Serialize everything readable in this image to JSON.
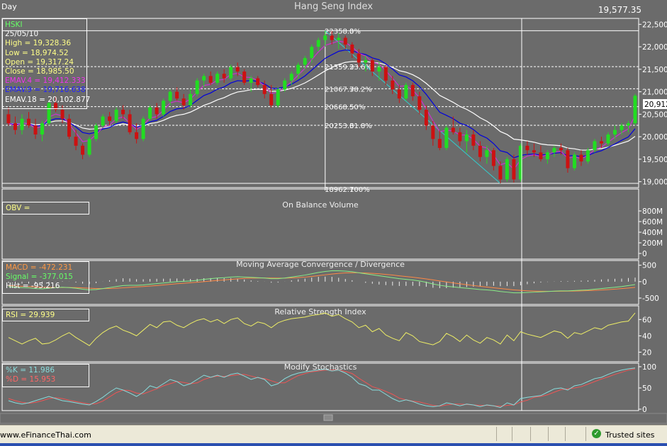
{
  "window": {
    "period": "Day",
    "title": "Hang Seng Index",
    "last_price": "19,577.35"
  },
  "colors": {
    "background": "#6b6b6b",
    "panel_border": "#ffffff",
    "up_candle": "#22dd22",
    "down_candle": "#cc1111",
    "ema4": "#cc33cc",
    "ema9": "#0000dd",
    "ema18": "#ffffff",
    "fib_line": "#ffffff",
    "trend_line": "#33cccc",
    "macd_line": "#88ee88",
    "macd_signal": "#ff8844",
    "rsi_line": "#eeee66",
    "stoch_k": "#88dddd",
    "stoch_d": "#ee5555",
    "info_text_yellow": "#ffff88",
    "info_text_green": "#66ff66"
  },
  "price_panel": {
    "info": {
      "symbol": "HSKI",
      "date": "25/05/10",
      "high": "High  = 19,328.36",
      "low": "Low  = 18,974.52",
      "open": "Open = 19,317.24",
      "close": "Close = 18,985.50",
      "ema4": "EMAV.4 = 19,412.333",
      "ema9": "EMAV.9 = 19,716.638",
      "ema18": "EMAV.18 = 20,102.877"
    },
    "axis_labels": [
      "22,500",
      "22,000",
      "21,500",
      "21,000",
      "20,500",
      "20,000",
      "19,500",
      "19,000"
    ],
    "last_value_tag": "20,912",
    "fib_levels": [
      {
        "value": "22358.3",
        "pct": "0%"
      },
      {
        "value": "21559.3",
        "pct": "23.6%"
      },
      {
        "value": "21067.7",
        "pct": "38.2%"
      },
      {
        "value": "20668.5",
        "pct": "50%"
      },
      {
        "value": "20253.3",
        "pct": "61.8%"
      },
      {
        "value": "18962.7",
        "pct": "100%"
      }
    ]
  },
  "obv_panel": {
    "title": "On Balance Volume",
    "info": "OBV =",
    "axis_labels": [
      "800M",
      "600M",
      "400M",
      "200M",
      "0"
    ]
  },
  "macd_panel": {
    "title": "Moving Average Convergence / Divergence",
    "info": {
      "macd": "MACD = -472.231",
      "signal": "Signal = -377.015",
      "hist": "Hist = -95.216"
    },
    "axis_labels": [
      "500",
      "0",
      "-500"
    ]
  },
  "rsi_panel": {
    "title": "Relative Strength Index",
    "info": "RSI = 29.939",
    "axis_labels": [
      "60",
      "40",
      "20"
    ]
  },
  "stoch_panel": {
    "title": "Modify Stochastics",
    "info": {
      "k": "%K = 11.986",
      "d": "%D = 15.953"
    },
    "axis_labels": [
      "100",
      "50",
      "0"
    ]
  },
  "statusbar": {
    "url": "www.eFinanceThai.com",
    "security": "Trusted sites"
  },
  "chart_data": {
    "type": "candlestick",
    "title": "Hang Seng Index",
    "price_range": [
      18900,
      22600
    ],
    "candles": [
      {
        "o": 20500,
        "h": 20650,
        "l": 20250,
        "c": 20300
      },
      {
        "o": 20300,
        "h": 20450,
        "l": 20050,
        "c": 20150
      },
      {
        "o": 20150,
        "h": 20500,
        "l": 20050,
        "c": 20400
      },
      {
        "o": 20400,
        "h": 20550,
        "l": 20200,
        "c": 20250
      },
      {
        "o": 20250,
        "h": 20400,
        "l": 19950,
        "c": 20050
      },
      {
        "o": 20050,
        "h": 20350,
        "l": 19900,
        "c": 20300
      },
      {
        "o": 20300,
        "h": 20800,
        "l": 20250,
        "c": 20750
      },
      {
        "o": 20750,
        "h": 20900,
        "l": 20550,
        "c": 20600
      },
      {
        "o": 20600,
        "h": 20700,
        "l": 20300,
        "c": 20400
      },
      {
        "o": 20400,
        "h": 20500,
        "l": 19950,
        "c": 20000
      },
      {
        "o": 20000,
        "h": 20150,
        "l": 19700,
        "c": 19800
      },
      {
        "o": 19800,
        "h": 19850,
        "l": 19500,
        "c": 19600
      },
      {
        "o": 19600,
        "h": 20000,
        "l": 19550,
        "c": 19950
      },
      {
        "o": 19950,
        "h": 20300,
        "l": 19900,
        "c": 20250
      },
      {
        "o": 20250,
        "h": 20500,
        "l": 20200,
        "c": 20450
      },
      {
        "o": 20450,
        "h": 20550,
        "l": 20250,
        "c": 20350
      },
      {
        "o": 20350,
        "h": 20650,
        "l": 20300,
        "c": 20600
      },
      {
        "o": 20600,
        "h": 20700,
        "l": 20400,
        "c": 20500
      },
      {
        "o": 20500,
        "h": 20600,
        "l": 20050,
        "c": 20100
      },
      {
        "o": 20100,
        "h": 20300,
        "l": 19850,
        "c": 19950
      },
      {
        "o": 19950,
        "h": 20450,
        "l": 19900,
        "c": 20400
      },
      {
        "o": 20400,
        "h": 20700,
        "l": 20350,
        "c": 20650
      },
      {
        "o": 20650,
        "h": 20750,
        "l": 20400,
        "c": 20500
      },
      {
        "o": 20500,
        "h": 20850,
        "l": 20450,
        "c": 20800
      },
      {
        "o": 20800,
        "h": 21050,
        "l": 20700,
        "c": 21000
      },
      {
        "o": 21000,
        "h": 21100,
        "l": 20800,
        "c": 20850
      },
      {
        "o": 20850,
        "h": 20950,
        "l": 20600,
        "c": 20700
      },
      {
        "o": 20700,
        "h": 21050,
        "l": 20650,
        "c": 20950
      },
      {
        "o": 20950,
        "h": 21300,
        "l": 20900,
        "c": 21250
      },
      {
        "o": 21250,
        "h": 21400,
        "l": 21100,
        "c": 21350
      },
      {
        "o": 21350,
        "h": 21450,
        "l": 21150,
        "c": 21200
      },
      {
        "o": 21200,
        "h": 21450,
        "l": 21150,
        "c": 21400
      },
      {
        "o": 21400,
        "h": 21500,
        "l": 21200,
        "c": 21300
      },
      {
        "o": 21300,
        "h": 21600,
        "l": 21250,
        "c": 21550
      },
      {
        "o": 21550,
        "h": 21650,
        "l": 21350,
        "c": 21450
      },
      {
        "o": 21450,
        "h": 21500,
        "l": 21150,
        "c": 21200
      },
      {
        "o": 21200,
        "h": 21350,
        "l": 21000,
        "c": 21300
      },
      {
        "o": 21300,
        "h": 21350,
        "l": 21100,
        "c": 21150
      },
      {
        "o": 21150,
        "h": 21250,
        "l": 20850,
        "c": 20950
      },
      {
        "o": 20950,
        "h": 21150,
        "l": 20650,
        "c": 20700
      },
      {
        "o": 20700,
        "h": 21100,
        "l": 20650,
        "c": 21050
      },
      {
        "o": 21050,
        "h": 21300,
        "l": 21000,
        "c": 21250
      },
      {
        "o": 21250,
        "h": 21450,
        "l": 21150,
        "c": 21400
      },
      {
        "o": 21400,
        "h": 21650,
        "l": 21300,
        "c": 21600
      },
      {
        "o": 21600,
        "h": 21800,
        "l": 21500,
        "c": 21750
      },
      {
        "o": 21750,
        "h": 22050,
        "l": 21650,
        "c": 22000
      },
      {
        "o": 22000,
        "h": 22200,
        "l": 21900,
        "c": 22150
      },
      {
        "o": 22150,
        "h": 22358,
        "l": 22000,
        "c": 22250
      },
      {
        "o": 22250,
        "h": 22350,
        "l": 22050,
        "c": 22150
      },
      {
        "o": 22150,
        "h": 22300,
        "l": 21950,
        "c": 22200
      },
      {
        "o": 22200,
        "h": 22250,
        "l": 21950,
        "c": 22050
      },
      {
        "o": 22050,
        "h": 22100,
        "l": 21750,
        "c": 21850
      },
      {
        "o": 21850,
        "h": 21950,
        "l": 21550,
        "c": 21650
      },
      {
        "o": 21650,
        "h": 21800,
        "l": 21450,
        "c": 21700
      },
      {
        "o": 21700,
        "h": 21750,
        "l": 21350,
        "c": 21450
      },
      {
        "o": 21450,
        "h": 21650,
        "l": 21250,
        "c": 21550
      },
      {
        "o": 21550,
        "h": 21600,
        "l": 21150,
        "c": 21250
      },
      {
        "o": 21250,
        "h": 21350,
        "l": 20950,
        "c": 21050
      },
      {
        "o": 21050,
        "h": 21150,
        "l": 20750,
        "c": 20850
      },
      {
        "o": 20850,
        "h": 21200,
        "l": 20800,
        "c": 21150
      },
      {
        "o": 21150,
        "h": 21200,
        "l": 20800,
        "c": 20900
      },
      {
        "o": 20900,
        "h": 21000,
        "l": 20500,
        "c": 20600
      },
      {
        "o": 20600,
        "h": 20700,
        "l": 20150,
        "c": 20250
      },
      {
        "o": 20250,
        "h": 20350,
        "l": 19800,
        "c": 19950
      },
      {
        "o": 19950,
        "h": 20150,
        "l": 19700,
        "c": 19750
      },
      {
        "o": 19750,
        "h": 20250,
        "l": 19700,
        "c": 20200
      },
      {
        "o": 20200,
        "h": 20450,
        "l": 20050,
        "c": 20100
      },
      {
        "o": 20100,
        "h": 20200,
        "l": 19800,
        "c": 19900
      },
      {
        "o": 19900,
        "h": 20150,
        "l": 19650,
        "c": 20050
      },
      {
        "o": 20050,
        "h": 20150,
        "l": 19700,
        "c": 19800
      },
      {
        "o": 19800,
        "h": 19900,
        "l": 19450,
        "c": 19550
      },
      {
        "o": 19550,
        "h": 19800,
        "l": 19400,
        "c": 19700
      },
      {
        "o": 19700,
        "h": 19750,
        "l": 19250,
        "c": 19350
      },
      {
        "o": 19350,
        "h": 19450,
        "l": 18962,
        "c": 19050
      },
      {
        "o": 19050,
        "h": 19550,
        "l": 19000,
        "c": 19500
      },
      {
        "o": 19500,
        "h": 19600,
        "l": 18980,
        "c": 19050
      },
      {
        "o": 19050,
        "h": 19850,
        "l": 19000,
        "c": 19800
      },
      {
        "o": 19800,
        "h": 19900,
        "l": 19600,
        "c": 19700
      },
      {
        "o": 19700,
        "h": 19850,
        "l": 19550,
        "c": 19650
      },
      {
        "o": 19650,
        "h": 19800,
        "l": 19450,
        "c": 19500
      },
      {
        "o": 19500,
        "h": 19700,
        "l": 19400,
        "c": 19650
      },
      {
        "o": 19650,
        "h": 19800,
        "l": 19550,
        "c": 19750
      },
      {
        "o": 19750,
        "h": 19850,
        "l": 19600,
        "c": 19700
      },
      {
        "o": 19700,
        "h": 19750,
        "l": 19200,
        "c": 19300
      },
      {
        "o": 19300,
        "h": 19650,
        "l": 19250,
        "c": 19600
      },
      {
        "o": 19600,
        "h": 19700,
        "l": 19350,
        "c": 19450
      },
      {
        "o": 19450,
        "h": 19750,
        "l": 19400,
        "c": 19700
      },
      {
        "o": 19700,
        "h": 19950,
        "l": 19650,
        "c": 19900
      },
      {
        "o": 19900,
        "h": 20000,
        "l": 19750,
        "c": 19850
      },
      {
        "o": 19850,
        "h": 20100,
        "l": 19800,
        "c": 20050
      },
      {
        "o": 20050,
        "h": 20250,
        "l": 19950,
        "c": 20150
      },
      {
        "o": 20150,
        "h": 20300,
        "l": 20050,
        "c": 20250
      },
      {
        "o": 20250,
        "h": 20350,
        "l": 20100,
        "c": 20300
      },
      {
        "o": 20300,
        "h": 20950,
        "l": 20250,
        "c": 20912
      }
    ],
    "macd_range": [
      -650,
      600
    ],
    "rsi_range": [
      10,
      75
    ],
    "stoch_range": [
      0,
      105
    ],
    "macd": [
      -150,
      -170,
      -180,
      -190,
      -210,
      -220,
      -200,
      -180,
      -170,
      -180,
      -200,
      -230,
      -250,
      -240,
      -210,
      -180,
      -150,
      -120,
      -110,
      -110,
      -100,
      -80,
      -60,
      -40,
      -20,
      0,
      10,
      20,
      40,
      70,
      90,
      110,
      120,
      140,
      150,
      140,
      130,
      120,
      110,
      90,
      90,
      110,
      140,
      170,
      200,
      240,
      280,
      310,
      330,
      330,
      320,
      300,
      270,
      240,
      210,
      180,
      150,
      120,
      90,
      70,
      50,
      20,
      -20,
      -70,
      -110,
      -140,
      -160,
      -180,
      -200,
      -220,
      -240,
      -250,
      -270,
      -300,
      -320,
      -340,
      -340,
      -330,
      -320,
      -310,
      -300,
      -290,
      -280,
      -280,
      -270,
      -260,
      -250,
      -230,
      -210,
      -190,
      -170,
      -150,
      -120,
      -90
    ],
    "signal": [
      -120,
      -130,
      -140,
      -150,
      -160,
      -170,
      -175,
      -178,
      -178,
      -178,
      -182,
      -190,
      -200,
      -210,
      -212,
      -208,
      -200,
      -188,
      -174,
      -160,
      -148,
      -134,
      -118,
      -100,
      -82,
      -64,
      -48,
      -34,
      -18,
      0,
      18,
      36,
      52,
      70,
      86,
      98,
      106,
      110,
      112,
      110,
      108,
      108,
      114,
      124,
      138,
      158,
      182,
      208,
      232,
      252,
      266,
      272,
      270,
      264,
      252,
      238,
      220,
      200,
      178,
      156,
      134,
      110,
      84,
      54,
      22,
      -8,
      -38,
      -66,
      -92,
      -118,
      -142,
      -164,
      -186,
      -208,
      -230,
      -250,
      -266,
      -278,
      -286,
      -292,
      -294,
      -294,
      -292,
      -290,
      -286,
      -280,
      -274,
      -266,
      -254,
      -242,
      -228,
      -212,
      -194,
      -172
    ],
    "rsi": [
      38,
      34,
      30,
      34,
      37,
      30,
      31,
      35,
      40,
      44,
      38,
      33,
      28,
      37,
      44,
      49,
      52,
      47,
      44,
      40,
      47,
      54,
      50,
      57,
      58,
      53,
      50,
      55,
      59,
      61,
      57,
      60,
      55,
      60,
      62,
      55,
      52,
      57,
      55,
      50,
      56,
      59,
      61,
      62,
      63,
      65,
      66,
      68,
      64,
      66,
      61,
      57,
      50,
      53,
      45,
      49,
      41,
      37,
      34,
      44,
      40,
      33,
      31,
      29,
      33,
      43,
      39,
      33,
      41,
      35,
      31,
      38,
      35,
      30,
      41,
      34,
      45,
      42,
      40,
      38,
      42,
      46,
      44,
      37,
      44,
      42,
      46,
      50,
      48,
      53,
      55,
      57,
      58,
      68
    ],
    "stoch_k": [
      20,
      15,
      12,
      15,
      20,
      25,
      30,
      25,
      20,
      18,
      15,
      12,
      10,
      18,
      28,
      40,
      50,
      45,
      38,
      30,
      40,
      55,
      50,
      60,
      70,
      65,
      55,
      60,
      70,
      80,
      75,
      80,
      75,
      82,
      85,
      78,
      70,
      75,
      70,
      55,
      60,
      72,
      80,
      85,
      88,
      90,
      92,
      94,
      90,
      92,
      85,
      75,
      60,
      55,
      45,
      45,
      35,
      25,
      18,
      22,
      18,
      12,
      8,
      6,
      8,
      15,
      12,
      8,
      12,
      10,
      6,
      10,
      8,
      4,
      15,
      10,
      25,
      28,
      30,
      32,
      40,
      48,
      50,
      45,
      55,
      58,
      65,
      72,
      75,
      82,
      88,
      92,
      95,
      97
    ],
    "stoch_d": [
      25,
      20,
      16,
      14,
      16,
      20,
      25,
      27,
      25,
      21,
      18,
      15,
      12,
      13,
      19,
      29,
      39,
      45,
      44,
      38,
      36,
      42,
      48,
      55,
      60,
      65,
      63,
      60,
      62,
      70,
      75,
      78,
      77,
      79,
      81,
      82,
      78,
      74,
      72,
      67,
      62,
      62,
      71,
      79,
      84,
      88,
      90,
      92,
      92,
      92,
      89,
      84,
      73,
      63,
      53,
      48,
      42,
      35,
      26,
      22,
      19,
      17,
      13,
      9,
      7,
      10,
      12,
      12,
      11,
      10,
      9,
      9,
      8,
      7,
      9,
      10,
      17,
      21,
      28,
      30,
      34,
      40,
      46,
      48,
      50,
      53,
      59,
      65,
      71,
      76,
      82,
      87,
      92,
      95
    ]
  }
}
